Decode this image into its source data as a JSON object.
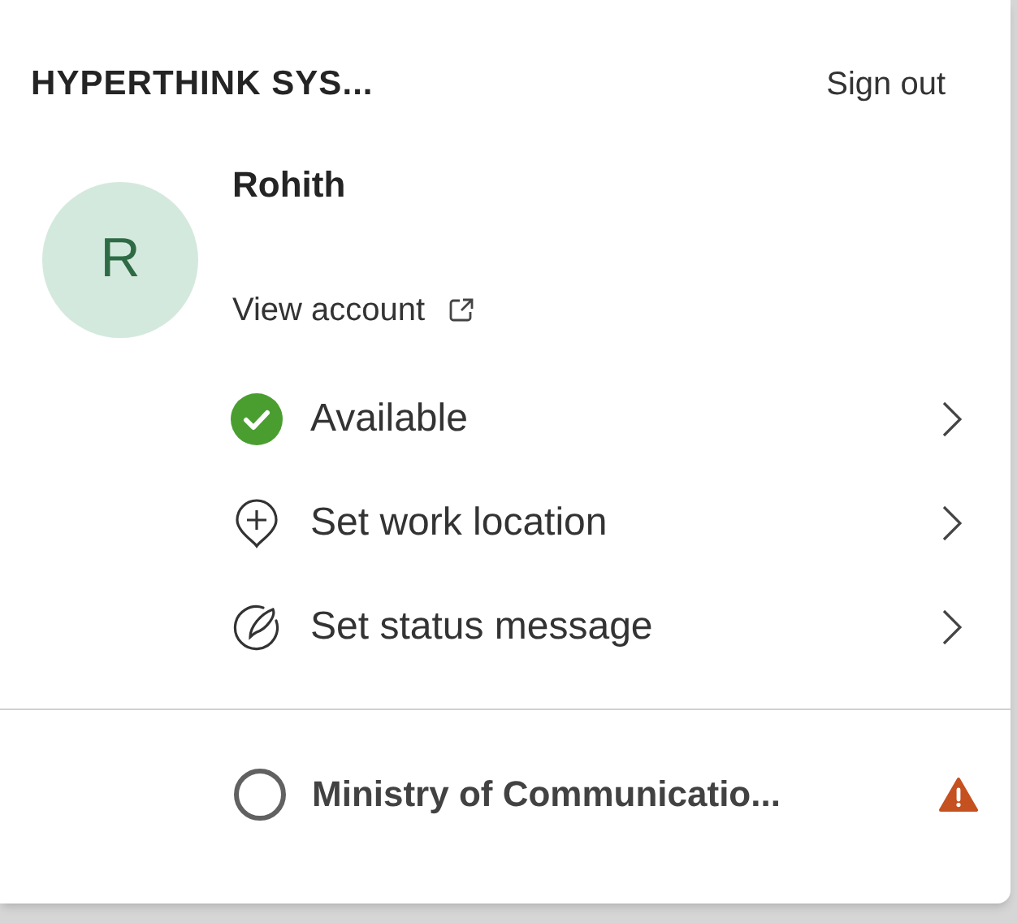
{
  "organization": "HYPERTHINK SYS...",
  "sign_out": "Sign out",
  "profile": {
    "initial": "R",
    "name": "Rohith",
    "view_account": "View account"
  },
  "menu": [
    {
      "kind": "status",
      "label": "Available"
    },
    {
      "kind": "location",
      "label": "Set work location"
    },
    {
      "kind": "message",
      "label": "Set status message"
    }
  ],
  "accounts": [
    {
      "name": "Ministry of Communicatio...",
      "selected": false,
      "warning": true
    }
  ]
}
